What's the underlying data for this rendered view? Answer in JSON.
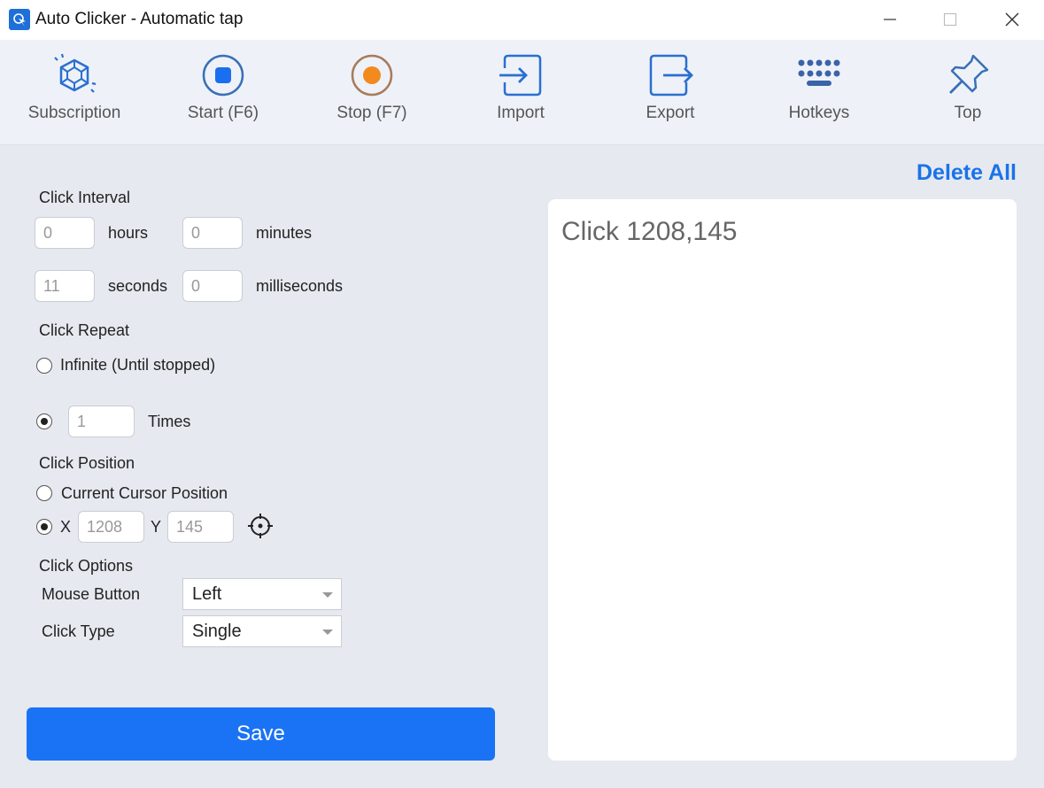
{
  "window": {
    "title": "Auto Clicker - Automatic tap"
  },
  "toolbar": {
    "items": [
      {
        "label": "Subscription",
        "icon": "diamond-icon"
      },
      {
        "label": "Start (F6)",
        "icon": "record-start-icon"
      },
      {
        "label": "Stop (F7)",
        "icon": "record-stop-icon"
      },
      {
        "label": "Import",
        "icon": "import-icon"
      },
      {
        "label": "Export",
        "icon": "export-icon"
      },
      {
        "label": "Hotkeys",
        "icon": "keyboard-icon"
      },
      {
        "label": "Top",
        "icon": "pin-icon"
      }
    ]
  },
  "interval": {
    "heading": "Click Interval",
    "hours_value": "0",
    "hours_label": "hours",
    "minutes_value": "0",
    "minutes_label": "minutes",
    "seconds_value": "11",
    "seconds_label": "seconds",
    "milliseconds_value": "0",
    "milliseconds_label": "milliseconds"
  },
  "repeat": {
    "heading": "Click Repeat",
    "infinite_label": "Infinite (Until stopped)",
    "times_value": "1",
    "times_label": "Times",
    "selected": "times"
  },
  "position": {
    "heading": "Click Position",
    "cursor_label": "Current Cursor Position",
    "x_label": "X",
    "x_value": "1208",
    "y_label": "Y",
    "y_value": "145",
    "selected": "xy"
  },
  "options": {
    "heading": "Click Options",
    "mouse_button_label": "Mouse Button",
    "mouse_button_value": "Left",
    "click_type_label": "Click Type",
    "click_type_value": "Single"
  },
  "save_label": "Save",
  "log": {
    "delete_all_label": "Delete All",
    "entries": [
      "Click 1208,145"
    ]
  },
  "colors": {
    "accent": "#1a73f5",
    "stop_orange": "#f28a1e",
    "icon_blue": "#1f6fd8"
  }
}
